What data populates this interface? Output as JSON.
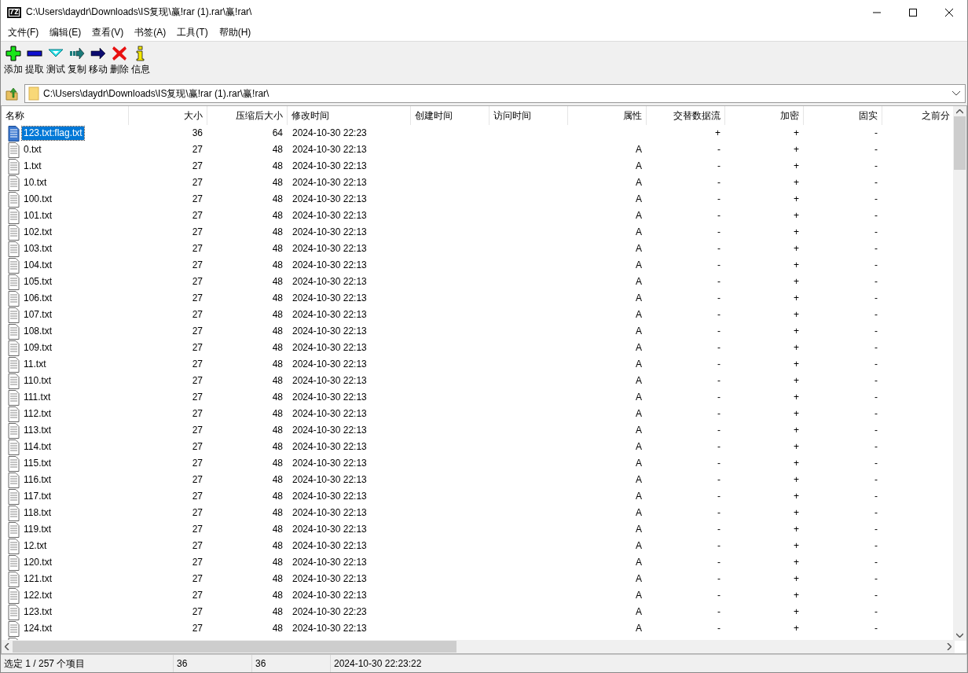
{
  "window": {
    "logo_text": "7z",
    "title": "C:\\Users\\daydr\\Downloads\\IS复现\\赢!rar (1).rar\\赢!rar\\"
  },
  "menu": [
    "文件(F)",
    "编辑(E)",
    "查看(V)",
    "书签(A)",
    "工具(T)",
    "帮助(H)"
  ],
  "toolbar": [
    {
      "kind": "add",
      "label": "添加"
    },
    {
      "kind": "extract",
      "label": "提取"
    },
    {
      "kind": "test",
      "label": "测试"
    },
    {
      "kind": "copy",
      "label": "复制"
    },
    {
      "kind": "move",
      "label": "移动"
    },
    {
      "kind": "delete",
      "label": "删除"
    },
    {
      "kind": "info",
      "label": "信息"
    }
  ],
  "address": {
    "value": "C:\\Users\\daydr\\Downloads\\IS复现\\赢!rar (1).rar\\赢!rar\\"
  },
  "table": {
    "columns": [
      "名称",
      "大小",
      "压缩后大小",
      "修改时间",
      "创建时间",
      "访问时间",
      "属性",
      "交替数据流",
      "加密",
      "固实",
      "之前分"
    ],
    "rows": [
      {
        "name": "123.txt:flag.txt",
        "size": "36",
        "packed": "64",
        "modified": "2024-10-30 22:23",
        "attributes": "",
        "alt_streams": "+",
        "encrypted": "+",
        "solid": "-",
        "selected": true
      },
      {
        "name": "0.txt",
        "size": "27",
        "packed": "48",
        "modified": "2024-10-30 22:13",
        "attributes": "A",
        "alt_streams": "-",
        "encrypted": "+",
        "solid": "-",
        "selected": false
      },
      {
        "name": "1.txt",
        "size": "27",
        "packed": "48",
        "modified": "2024-10-30 22:13",
        "attributes": "A",
        "alt_streams": "-",
        "encrypted": "+",
        "solid": "-",
        "selected": false
      },
      {
        "name": "10.txt",
        "size": "27",
        "packed": "48",
        "modified": "2024-10-30 22:13",
        "attributes": "A",
        "alt_streams": "-",
        "encrypted": "+",
        "solid": "-",
        "selected": false
      },
      {
        "name": "100.txt",
        "size": "27",
        "packed": "48",
        "modified": "2024-10-30 22:13",
        "attributes": "A",
        "alt_streams": "-",
        "encrypted": "+",
        "solid": "-",
        "selected": false
      },
      {
        "name": "101.txt",
        "size": "27",
        "packed": "48",
        "modified": "2024-10-30 22:13",
        "attributes": "A",
        "alt_streams": "-",
        "encrypted": "+",
        "solid": "-",
        "selected": false
      },
      {
        "name": "102.txt",
        "size": "27",
        "packed": "48",
        "modified": "2024-10-30 22:13",
        "attributes": "A",
        "alt_streams": "-",
        "encrypted": "+",
        "solid": "-",
        "selected": false
      },
      {
        "name": "103.txt",
        "size": "27",
        "packed": "48",
        "modified": "2024-10-30 22:13",
        "attributes": "A",
        "alt_streams": "-",
        "encrypted": "+",
        "solid": "-",
        "selected": false
      },
      {
        "name": "104.txt",
        "size": "27",
        "packed": "48",
        "modified": "2024-10-30 22:13",
        "attributes": "A",
        "alt_streams": "-",
        "encrypted": "+",
        "solid": "-",
        "selected": false
      },
      {
        "name": "105.txt",
        "size": "27",
        "packed": "48",
        "modified": "2024-10-30 22:13",
        "attributes": "A",
        "alt_streams": "-",
        "encrypted": "+",
        "solid": "-",
        "selected": false
      },
      {
        "name": "106.txt",
        "size": "27",
        "packed": "48",
        "modified": "2024-10-30 22:13",
        "attributes": "A",
        "alt_streams": "-",
        "encrypted": "+",
        "solid": "-",
        "selected": false
      },
      {
        "name": "107.txt",
        "size": "27",
        "packed": "48",
        "modified": "2024-10-30 22:13",
        "attributes": "A",
        "alt_streams": "-",
        "encrypted": "+",
        "solid": "-",
        "selected": false
      },
      {
        "name": "108.txt",
        "size": "27",
        "packed": "48",
        "modified": "2024-10-30 22:13",
        "attributes": "A",
        "alt_streams": "-",
        "encrypted": "+",
        "solid": "-",
        "selected": false
      },
      {
        "name": "109.txt",
        "size": "27",
        "packed": "48",
        "modified": "2024-10-30 22:13",
        "attributes": "A",
        "alt_streams": "-",
        "encrypted": "+",
        "solid": "-",
        "selected": false
      },
      {
        "name": "11.txt",
        "size": "27",
        "packed": "48",
        "modified": "2024-10-30 22:13",
        "attributes": "A",
        "alt_streams": "-",
        "encrypted": "+",
        "solid": "-",
        "selected": false
      },
      {
        "name": "110.txt",
        "size": "27",
        "packed": "48",
        "modified": "2024-10-30 22:13",
        "attributes": "A",
        "alt_streams": "-",
        "encrypted": "+",
        "solid": "-",
        "selected": false
      },
      {
        "name": "111.txt",
        "size": "27",
        "packed": "48",
        "modified": "2024-10-30 22:13",
        "attributes": "A",
        "alt_streams": "-",
        "encrypted": "+",
        "solid": "-",
        "selected": false
      },
      {
        "name": "112.txt",
        "size": "27",
        "packed": "48",
        "modified": "2024-10-30 22:13",
        "attributes": "A",
        "alt_streams": "-",
        "encrypted": "+",
        "solid": "-",
        "selected": false
      },
      {
        "name": "113.txt",
        "size": "27",
        "packed": "48",
        "modified": "2024-10-30 22:13",
        "attributes": "A",
        "alt_streams": "-",
        "encrypted": "+",
        "solid": "-",
        "selected": false
      },
      {
        "name": "114.txt",
        "size": "27",
        "packed": "48",
        "modified": "2024-10-30 22:13",
        "attributes": "A",
        "alt_streams": "-",
        "encrypted": "+",
        "solid": "-",
        "selected": false
      },
      {
        "name": "115.txt",
        "size": "27",
        "packed": "48",
        "modified": "2024-10-30 22:13",
        "attributes": "A",
        "alt_streams": "-",
        "encrypted": "+",
        "solid": "-",
        "selected": false
      },
      {
        "name": "116.txt",
        "size": "27",
        "packed": "48",
        "modified": "2024-10-30 22:13",
        "attributes": "A",
        "alt_streams": "-",
        "encrypted": "+",
        "solid": "-",
        "selected": false
      },
      {
        "name": "117.txt",
        "size": "27",
        "packed": "48",
        "modified": "2024-10-30 22:13",
        "attributes": "A",
        "alt_streams": "-",
        "encrypted": "+",
        "solid": "-",
        "selected": false
      },
      {
        "name": "118.txt",
        "size": "27",
        "packed": "48",
        "modified": "2024-10-30 22:13",
        "attributes": "A",
        "alt_streams": "-",
        "encrypted": "+",
        "solid": "-",
        "selected": false
      },
      {
        "name": "119.txt",
        "size": "27",
        "packed": "48",
        "modified": "2024-10-30 22:13",
        "attributes": "A",
        "alt_streams": "-",
        "encrypted": "+",
        "solid": "-",
        "selected": false
      },
      {
        "name": "12.txt",
        "size": "27",
        "packed": "48",
        "modified": "2024-10-30 22:13",
        "attributes": "A",
        "alt_streams": "-",
        "encrypted": "+",
        "solid": "-",
        "selected": false
      },
      {
        "name": "120.txt",
        "size": "27",
        "packed": "48",
        "modified": "2024-10-30 22:13",
        "attributes": "A",
        "alt_streams": "-",
        "encrypted": "+",
        "solid": "-",
        "selected": false
      },
      {
        "name": "121.txt",
        "size": "27",
        "packed": "48",
        "modified": "2024-10-30 22:13",
        "attributes": "A",
        "alt_streams": "-",
        "encrypted": "+",
        "solid": "-",
        "selected": false
      },
      {
        "name": "122.txt",
        "size": "27",
        "packed": "48",
        "modified": "2024-10-30 22:13",
        "attributes": "A",
        "alt_streams": "-",
        "encrypted": "+",
        "solid": "-",
        "selected": false
      },
      {
        "name": "123.txt",
        "size": "27",
        "packed": "48",
        "modified": "2024-10-30 22:23",
        "attributes": "A",
        "alt_streams": "-",
        "encrypted": "+",
        "solid": "-",
        "selected": false
      },
      {
        "name": "124.txt",
        "size": "27",
        "packed": "48",
        "modified": "2024-10-30 22:13",
        "attributes": "A",
        "alt_streams": "-",
        "encrypted": "+",
        "solid": "-",
        "selected": false
      }
    ]
  },
  "status_bar": [
    "选定 1 / 257 个项目",
    "36",
    "36",
    "2024-10-30 22:23:22"
  ]
}
